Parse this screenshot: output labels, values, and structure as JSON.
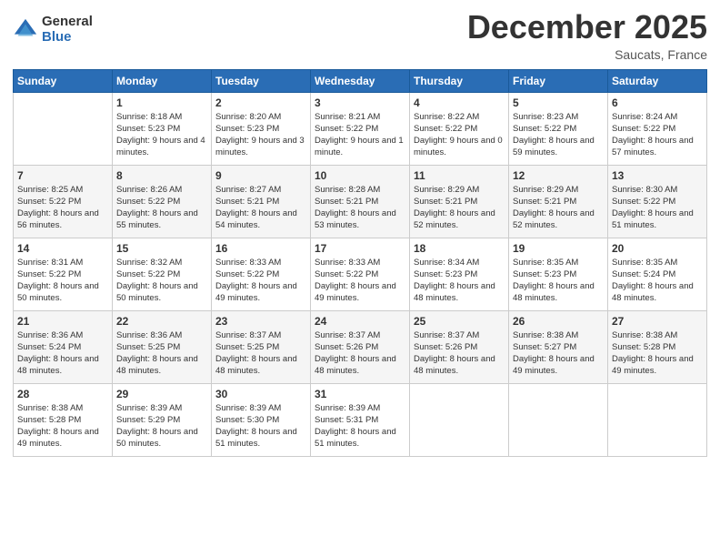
{
  "logo": {
    "general": "General",
    "blue": "Blue"
  },
  "title": "December 2025",
  "subtitle": "Saucats, France",
  "days_of_week": [
    "Sunday",
    "Monday",
    "Tuesday",
    "Wednesday",
    "Thursday",
    "Friday",
    "Saturday"
  ],
  "weeks": [
    [
      {
        "day": "",
        "sunrise": "",
        "sunset": "",
        "daylight": ""
      },
      {
        "day": "1",
        "sunrise": "Sunrise: 8:18 AM",
        "sunset": "Sunset: 5:23 PM",
        "daylight": "Daylight: 9 hours and 4 minutes."
      },
      {
        "day": "2",
        "sunrise": "Sunrise: 8:20 AM",
        "sunset": "Sunset: 5:23 PM",
        "daylight": "Daylight: 9 hours and 3 minutes."
      },
      {
        "day": "3",
        "sunrise": "Sunrise: 8:21 AM",
        "sunset": "Sunset: 5:22 PM",
        "daylight": "Daylight: 9 hours and 1 minute."
      },
      {
        "day": "4",
        "sunrise": "Sunrise: 8:22 AM",
        "sunset": "Sunset: 5:22 PM",
        "daylight": "Daylight: 9 hours and 0 minutes."
      },
      {
        "day": "5",
        "sunrise": "Sunrise: 8:23 AM",
        "sunset": "Sunset: 5:22 PM",
        "daylight": "Daylight: 8 hours and 59 minutes."
      },
      {
        "day": "6",
        "sunrise": "Sunrise: 8:24 AM",
        "sunset": "Sunset: 5:22 PM",
        "daylight": "Daylight: 8 hours and 57 minutes."
      }
    ],
    [
      {
        "day": "7",
        "sunrise": "Sunrise: 8:25 AM",
        "sunset": "Sunset: 5:22 PM",
        "daylight": "Daylight: 8 hours and 56 minutes."
      },
      {
        "day": "8",
        "sunrise": "Sunrise: 8:26 AM",
        "sunset": "Sunset: 5:22 PM",
        "daylight": "Daylight: 8 hours and 55 minutes."
      },
      {
        "day": "9",
        "sunrise": "Sunrise: 8:27 AM",
        "sunset": "Sunset: 5:21 PM",
        "daylight": "Daylight: 8 hours and 54 minutes."
      },
      {
        "day": "10",
        "sunrise": "Sunrise: 8:28 AM",
        "sunset": "Sunset: 5:21 PM",
        "daylight": "Daylight: 8 hours and 53 minutes."
      },
      {
        "day": "11",
        "sunrise": "Sunrise: 8:29 AM",
        "sunset": "Sunset: 5:21 PM",
        "daylight": "Daylight: 8 hours and 52 minutes."
      },
      {
        "day": "12",
        "sunrise": "Sunrise: 8:29 AM",
        "sunset": "Sunset: 5:21 PM",
        "daylight": "Daylight: 8 hours and 52 minutes."
      },
      {
        "day": "13",
        "sunrise": "Sunrise: 8:30 AM",
        "sunset": "Sunset: 5:22 PM",
        "daylight": "Daylight: 8 hours and 51 minutes."
      }
    ],
    [
      {
        "day": "14",
        "sunrise": "Sunrise: 8:31 AM",
        "sunset": "Sunset: 5:22 PM",
        "daylight": "Daylight: 8 hours and 50 minutes."
      },
      {
        "day": "15",
        "sunrise": "Sunrise: 8:32 AM",
        "sunset": "Sunset: 5:22 PM",
        "daylight": "Daylight: 8 hours and 50 minutes."
      },
      {
        "day": "16",
        "sunrise": "Sunrise: 8:33 AM",
        "sunset": "Sunset: 5:22 PM",
        "daylight": "Daylight: 8 hours and 49 minutes."
      },
      {
        "day": "17",
        "sunrise": "Sunrise: 8:33 AM",
        "sunset": "Sunset: 5:22 PM",
        "daylight": "Daylight: 8 hours and 49 minutes."
      },
      {
        "day": "18",
        "sunrise": "Sunrise: 8:34 AM",
        "sunset": "Sunset: 5:23 PM",
        "daylight": "Daylight: 8 hours and 48 minutes."
      },
      {
        "day": "19",
        "sunrise": "Sunrise: 8:35 AM",
        "sunset": "Sunset: 5:23 PM",
        "daylight": "Daylight: 8 hours and 48 minutes."
      },
      {
        "day": "20",
        "sunrise": "Sunrise: 8:35 AM",
        "sunset": "Sunset: 5:24 PM",
        "daylight": "Daylight: 8 hours and 48 minutes."
      }
    ],
    [
      {
        "day": "21",
        "sunrise": "Sunrise: 8:36 AM",
        "sunset": "Sunset: 5:24 PM",
        "daylight": "Daylight: 8 hours and 48 minutes."
      },
      {
        "day": "22",
        "sunrise": "Sunrise: 8:36 AM",
        "sunset": "Sunset: 5:25 PM",
        "daylight": "Daylight: 8 hours and 48 minutes."
      },
      {
        "day": "23",
        "sunrise": "Sunrise: 8:37 AM",
        "sunset": "Sunset: 5:25 PM",
        "daylight": "Daylight: 8 hours and 48 minutes."
      },
      {
        "day": "24",
        "sunrise": "Sunrise: 8:37 AM",
        "sunset": "Sunset: 5:26 PM",
        "daylight": "Daylight: 8 hours and 48 minutes."
      },
      {
        "day": "25",
        "sunrise": "Sunrise: 8:37 AM",
        "sunset": "Sunset: 5:26 PM",
        "daylight": "Daylight: 8 hours and 48 minutes."
      },
      {
        "day": "26",
        "sunrise": "Sunrise: 8:38 AM",
        "sunset": "Sunset: 5:27 PM",
        "daylight": "Daylight: 8 hours and 49 minutes."
      },
      {
        "day": "27",
        "sunrise": "Sunrise: 8:38 AM",
        "sunset": "Sunset: 5:28 PM",
        "daylight": "Daylight: 8 hours and 49 minutes."
      }
    ],
    [
      {
        "day": "28",
        "sunrise": "Sunrise: 8:38 AM",
        "sunset": "Sunset: 5:28 PM",
        "daylight": "Daylight: 8 hours and 49 minutes."
      },
      {
        "day": "29",
        "sunrise": "Sunrise: 8:39 AM",
        "sunset": "Sunset: 5:29 PM",
        "daylight": "Daylight: 8 hours and 50 minutes."
      },
      {
        "day": "30",
        "sunrise": "Sunrise: 8:39 AM",
        "sunset": "Sunset: 5:30 PM",
        "daylight": "Daylight: 8 hours and 51 minutes."
      },
      {
        "day": "31",
        "sunrise": "Sunrise: 8:39 AM",
        "sunset": "Sunset: 5:31 PM",
        "daylight": "Daylight: 8 hours and 51 minutes."
      },
      {
        "day": "",
        "sunrise": "",
        "sunset": "",
        "daylight": ""
      },
      {
        "day": "",
        "sunrise": "",
        "sunset": "",
        "daylight": ""
      },
      {
        "day": "",
        "sunrise": "",
        "sunset": "",
        "daylight": ""
      }
    ]
  ]
}
